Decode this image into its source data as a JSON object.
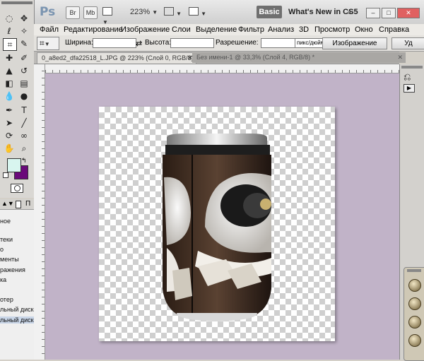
{
  "app": {
    "logo": "Ps",
    "bridge_label": "Br",
    "minibridge_label": "Mb",
    "zoom": "223%",
    "workspace": "Basic",
    "whats_new": "What's New in CS5"
  },
  "menu": [
    "Файл",
    "Редактирование",
    "Изображение",
    "Слои",
    "Выделение",
    "Фильтр",
    "Анализ",
    "3D",
    "Просмотр",
    "Окно",
    "Справка"
  ],
  "options": {
    "width_label": "Ширина:",
    "height_label": "Высота:",
    "resolution_label": "Разрешение:",
    "unit_value": "пикс/дюйм",
    "front_image_button": "Изображение",
    "delete_button_partial": "Уд"
  },
  "tabs": [
    {
      "label": "0_a8ed2_dfa22518_L.JPG @ 223% (Слой 0, RGB/8) *"
    },
    {
      "label": "Без имени-1 @ 33,3% (Слой 4, RGB/8) *"
    }
  ],
  "left_panel": {
    "header": "П",
    "items": [
      "ное",
      "теки",
      "о",
      "менты",
      "ражения",
      "ка",
      "отер",
      "льный диск (",
      "льный диск ("
    ]
  },
  "colors": {
    "canvas_bg": "#c1b3c8",
    "foreground_swatch": "#d8f5ef",
    "background_swatch": "#6a0a7a"
  }
}
